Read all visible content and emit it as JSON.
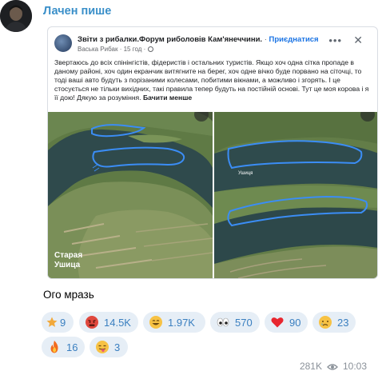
{
  "message": {
    "sender": "Лачен пише",
    "reply_text": "Ого мразь",
    "views": "281K",
    "time": "10:03"
  },
  "post": {
    "group_name": "Звіти з рибалки.Форум риболовів Кам'янеччини.",
    "separator": "·",
    "join_label": "Приєднатися",
    "author": "Васька Рибак",
    "age": "15 год",
    "body": "Звертаюсь до всіх спінінгістів, фідеристів і остальних туристів. Якщо хоч одна сітка пропаде в даному районі, хоч один екранчик витягните на берег, хоч одне вічко буде порвано на сіточці, то тоді ваші авто будуть з порізаними колесами, побитими вікнами, а можливо і згорять. І це стосується не тільки вихідних, такі правила тепер будуть на постійній основі. Тут це моя корова і я її дою! Дякую за розуміння.",
    "more_label": "Бачити менше",
    "photo_left_caption_1": "Старая",
    "photo_left_caption_2": "Ушица",
    "photo_right_label": "Ушиця"
  },
  "reactions": [
    {
      "icon": "star-icon",
      "count": "9"
    },
    {
      "icon": "angry-face-icon",
      "count": "14.5K"
    },
    {
      "icon": "grinning-face-icon",
      "count": "1.97K"
    },
    {
      "icon": "eyes-icon",
      "count": "570"
    },
    {
      "icon": "heart-icon",
      "count": "90"
    },
    {
      "icon": "crying-face-icon",
      "count": "23"
    },
    {
      "icon": "fire-icon",
      "count": "16"
    },
    {
      "icon": "tongue-face-icon",
      "count": "3"
    }
  ],
  "colors": {
    "accent": "#3a8fc9",
    "reaction_bg": "#e6eef6",
    "net_outline": "#3b8df5",
    "water": "#2e4a4e"
  }
}
